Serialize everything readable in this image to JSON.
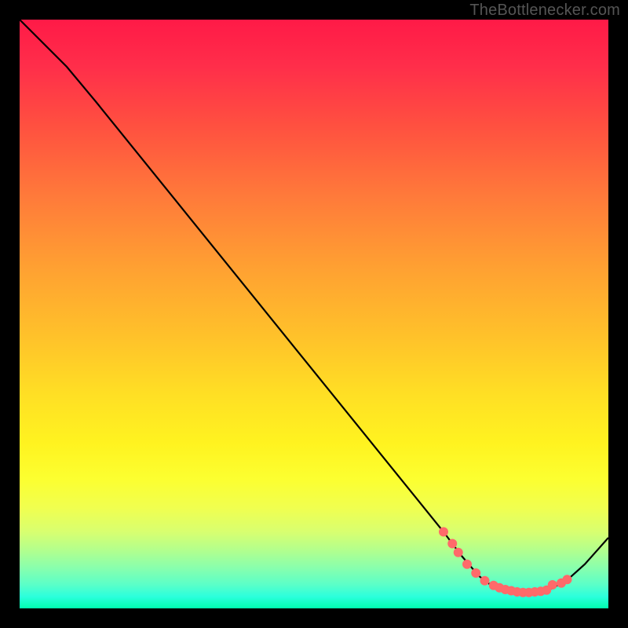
{
  "attribution": "TheBottlenecker.com",
  "chart_data": {
    "type": "line",
    "title": "",
    "xlabel": "",
    "ylabel": "",
    "xlim": [
      0,
      100
    ],
    "ylim": [
      0,
      100
    ],
    "curve": [
      {
        "x": 0,
        "y": 100
      },
      {
        "x": 8,
        "y": 92
      },
      {
        "x": 13,
        "y": 86
      },
      {
        "x": 72,
        "y": 13
      },
      {
        "x": 75,
        "y": 9
      },
      {
        "x": 78,
        "y": 5.5
      },
      {
        "x": 80,
        "y": 4
      },
      {
        "x": 83,
        "y": 3
      },
      {
        "x": 86,
        "y": 2.7
      },
      {
        "x": 90,
        "y": 3.2
      },
      {
        "x": 93,
        "y": 4.8
      },
      {
        "x": 96,
        "y": 7.5
      },
      {
        "x": 100,
        "y": 12
      }
    ],
    "markers": [
      {
        "x": 72.0,
        "y": 13.0
      },
      {
        "x": 73.5,
        "y": 11.0
      },
      {
        "x": 74.5,
        "y": 9.5
      },
      {
        "x": 76.0,
        "y": 7.5
      },
      {
        "x": 77.5,
        "y": 6.0
      },
      {
        "x": 79.0,
        "y": 4.7
      },
      {
        "x": 80.5,
        "y": 3.9
      },
      {
        "x": 81.5,
        "y": 3.5
      },
      {
        "x": 82.5,
        "y": 3.2
      },
      {
        "x": 83.5,
        "y": 3.0
      },
      {
        "x": 84.5,
        "y": 2.8
      },
      {
        "x": 85.5,
        "y": 2.7
      },
      {
        "x": 86.5,
        "y": 2.7
      },
      {
        "x": 87.5,
        "y": 2.8
      },
      {
        "x": 88.5,
        "y": 2.9
      },
      {
        "x": 89.5,
        "y": 3.1
      },
      {
        "x": 90.5,
        "y": 4.0
      },
      {
        "x": 92.0,
        "y": 4.3
      },
      {
        "x": 93.0,
        "y": 4.9
      }
    ],
    "marker_color": "#ff6a6a",
    "line_color": "#000000",
    "background": "red-green-gradient"
  }
}
